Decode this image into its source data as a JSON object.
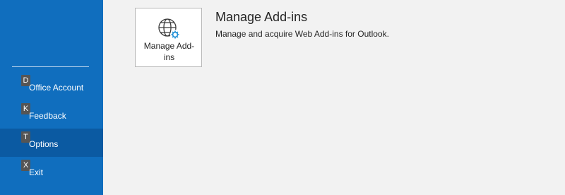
{
  "sidebar": {
    "items": [
      {
        "label": "Office Account",
        "keytip": "D",
        "selected": false
      },
      {
        "label": "Feedback",
        "keytip": "K",
        "selected": false
      },
      {
        "label": "Options",
        "keytip": "T",
        "selected": true
      },
      {
        "label": "Exit",
        "keytip": "X",
        "selected": false
      }
    ]
  },
  "main": {
    "tile": {
      "label_line1": "Manage Add-",
      "label_line2": "ins",
      "icon": "globe-gear-icon"
    },
    "title": "Manage Add-ins",
    "description": "Manage and acquire Web Add-ins for Outlook."
  },
  "colors": {
    "sidebar_bg": "#106ebe",
    "sidebar_selected": "#0b5aa2",
    "page_bg": "#f2f2f2",
    "keytip_bg": "#555555",
    "gear_accent": "#1e8fd6"
  }
}
